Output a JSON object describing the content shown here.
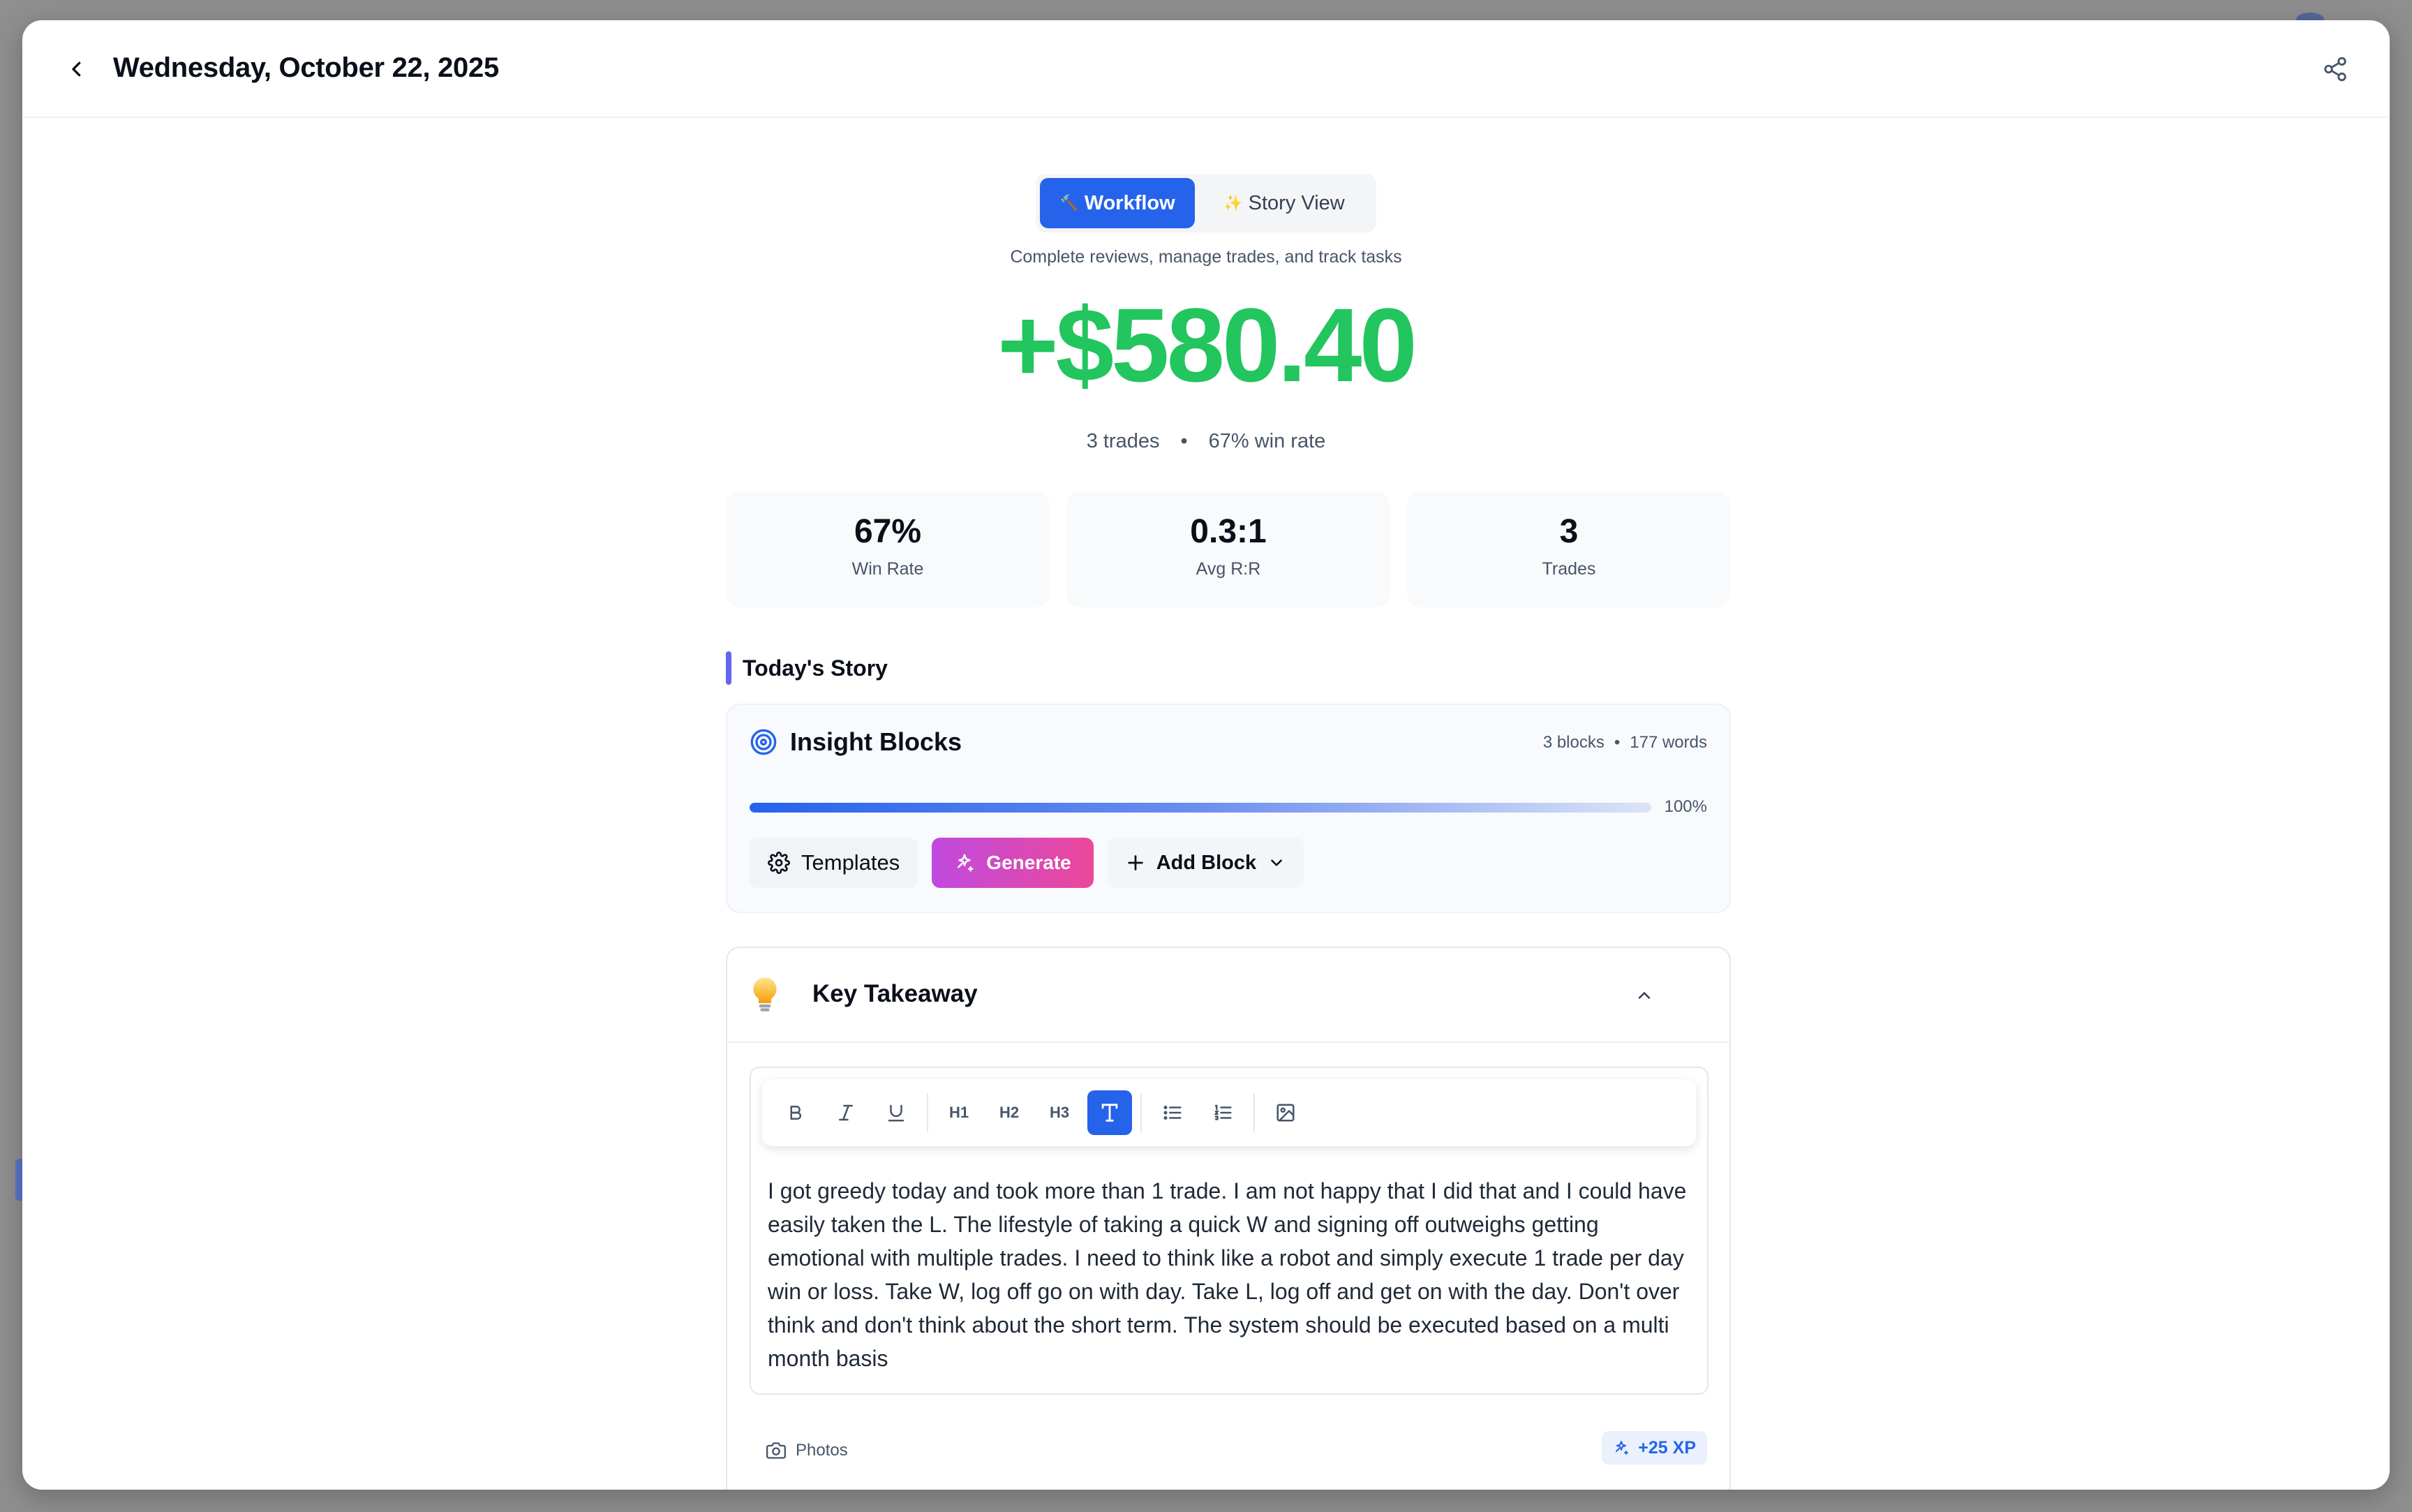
{
  "header": {
    "title": "Wednesday, October 22, 2025",
    "back_icon": "chevron-left-icon",
    "share_icon": "share-icon"
  },
  "view_toggle": {
    "workflow_label": "Workflow",
    "workflow_icon": "🔨",
    "story_label": "Story View",
    "story_icon": "✨",
    "active": "Workflow",
    "description": "Complete reviews, manage trades, and track tasks"
  },
  "summary": {
    "pnl": "+$580.40",
    "trades_text": "3 trades",
    "separator": "•",
    "win_rate_text": "67% win rate"
  },
  "stats": [
    {
      "value": "67%",
      "label": "Win Rate"
    },
    {
      "value": "0.3:1",
      "label": "Avg R:R"
    },
    {
      "value": "3",
      "label": "Trades"
    }
  ],
  "story": {
    "section_title": "Today's Story"
  },
  "insight_blocks": {
    "title": "Insight Blocks",
    "blocks_count": "3 blocks",
    "separator": "•",
    "word_count": "177 words",
    "progress_percent": 100,
    "progress_label": "100%",
    "templates_label": "Templates",
    "generate_label": "Generate",
    "add_block_label": "Add Block"
  },
  "key_takeaway": {
    "title": "Key Takeaway",
    "toolbar": {
      "bold": "B",
      "italic": "I",
      "underline": "U",
      "h1": "H1",
      "h2": "H2",
      "h3": "H3"
    },
    "text": "I got greedy today and took more than 1 trade. I am not happy that I did that and I could have easily taken the L. The lifestyle of taking a quick W and signing off outweighs getting emotional with multiple trades. I need to think like a robot and simply execute 1 trade per day win or loss. Take W, log off go on with day. Take L, log off and get on with the day. Don't over think and don't think about the short term. The system should be executed based on a multi month basis",
    "photos_label": "Photos",
    "xp_label": "+25 XP"
  },
  "colors": {
    "primary": "#2563eb",
    "profit": "#22c55e",
    "accent_bar": "#6366f1",
    "generate_gradient_start": "#c04ae0",
    "generate_gradient_end": "#ec4899"
  }
}
